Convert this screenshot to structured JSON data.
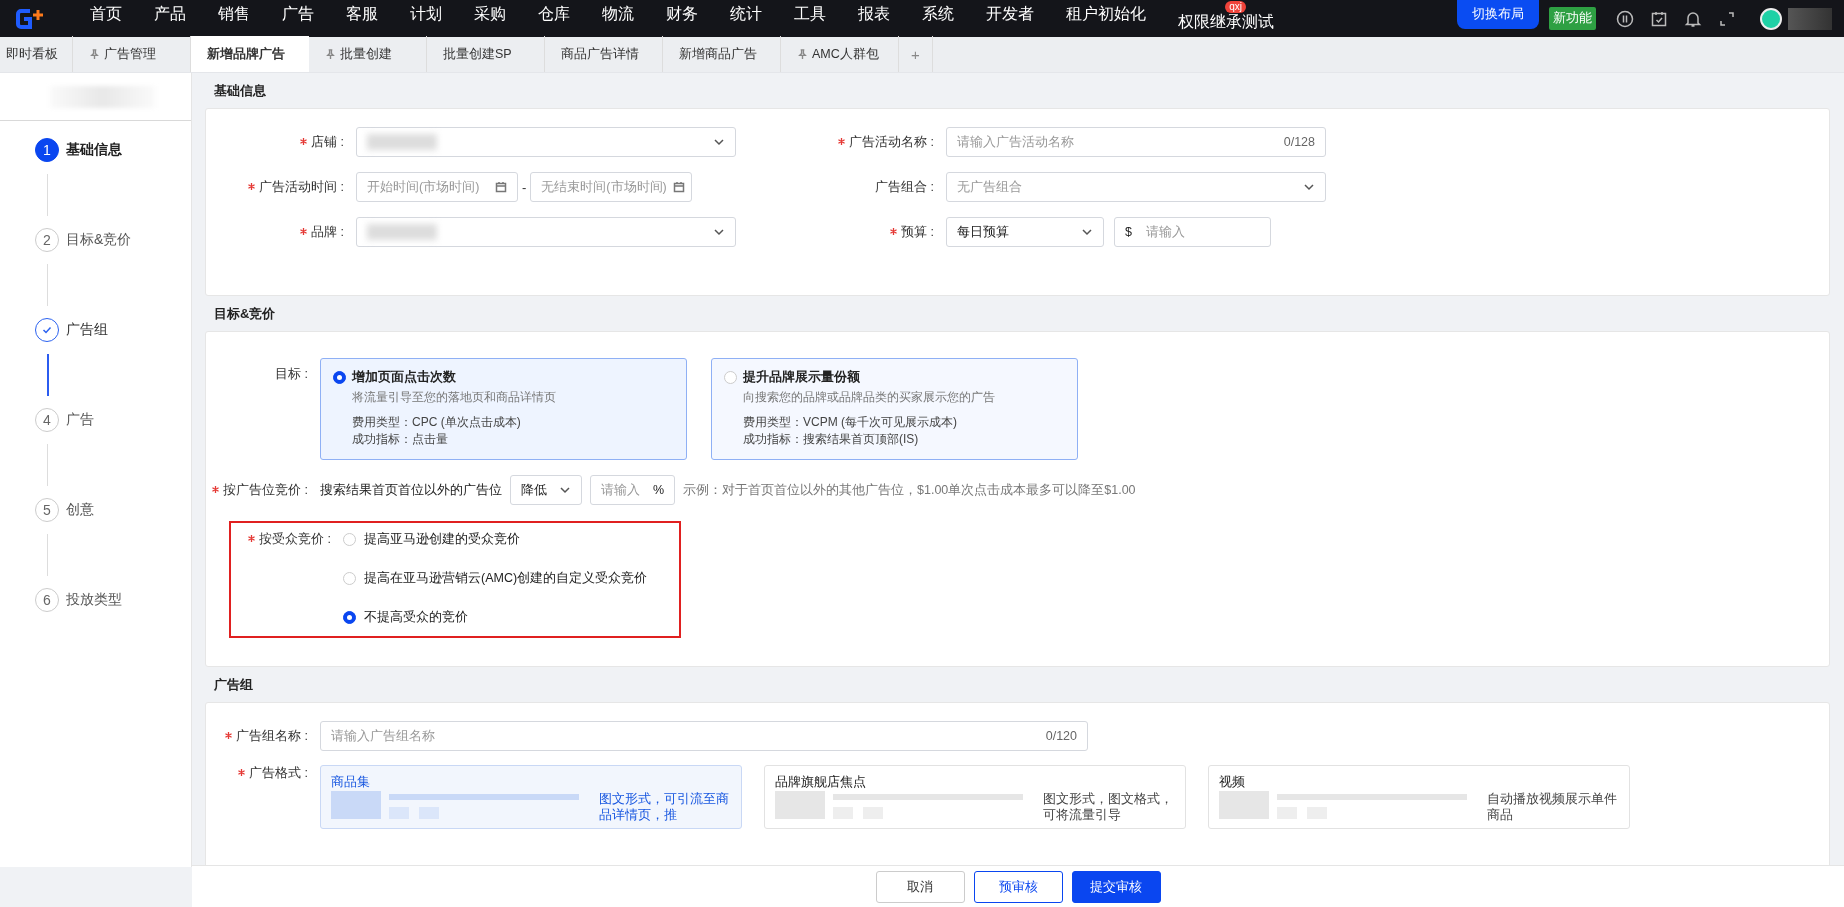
{
  "top_nav": {
    "menu": [
      "首页",
      "产品",
      "销售",
      "广告",
      "客服",
      "计划",
      "采购",
      "仓库",
      "物流",
      "财务",
      "统计",
      "工具",
      "报表",
      "系统",
      "开发者",
      "租户初始化",
      "权限继承测试"
    ],
    "badge": "qxj",
    "layout_button": "切换布局",
    "new_feature": "新功能"
  },
  "tabs": [
    {
      "label": "即时看板",
      "pinned": false,
      "selected": false
    },
    {
      "label": "广告管理",
      "pinned": true,
      "selected": false
    },
    {
      "label": "新增品牌广告",
      "pinned": false,
      "selected": true
    },
    {
      "label": "批量创建",
      "pinned": true,
      "selected": false
    },
    {
      "label": "批量创建SP",
      "pinned": false,
      "selected": false
    },
    {
      "label": "商品广告详情",
      "pinned": false,
      "selected": false
    },
    {
      "label": "新增商品广告",
      "pinned": false,
      "selected": false
    },
    {
      "label": "AMC人群包",
      "pinned": true,
      "selected": false
    }
  ],
  "add_tab": "+",
  "steps": [
    {
      "number": "1",
      "label": "基础信息",
      "kind": "active"
    },
    {
      "number": "2",
      "label": "目标&竞价",
      "kind": "wait"
    },
    {
      "label": "广告组",
      "kind": "done"
    },
    {
      "number": "4",
      "label": "广告",
      "kind": "wait"
    },
    {
      "number": "5",
      "label": "创意",
      "kind": "wait"
    },
    {
      "number": "6",
      "label": "投放类型",
      "kind": "wait"
    }
  ],
  "basic_info": {
    "title": "基础信息",
    "fields": [
      {
        "kind": "select",
        "label": "店铺 :",
        "required": true,
        "redacted": true
      },
      {
        "kind": "text",
        "label": "广告活动名称 :",
        "required": true,
        "placeholder": "请输入广告活动名称",
        "counter": "0/128"
      },
      {
        "kind": "daterange",
        "label": "广告活动时间 :",
        "required": true,
        "start_placeholder": "开始时间(市场时间)",
        "separator": "-",
        "end_placeholder": "无结束时间(市场时间)"
      },
      {
        "kind": "select",
        "label": "广告组合 :",
        "required": false,
        "placeholder": "无广告组合"
      },
      {
        "kind": "select",
        "label": "品牌 :",
        "required": true,
        "redacted": true
      },
      {
        "kind": "budget",
        "label": "预算 :",
        "required": true,
        "value": "每日预算",
        "prefix": "$",
        "placeholder": "请输入"
      }
    ]
  },
  "goal_bidding": {
    "title": "目标&竞价",
    "goal_label": "目标 :",
    "goals": [
      {
        "title": "增加页面点击次数",
        "description": "将流量引导至您的落地页和商品详情页",
        "cost_type": "费用类型：CPC (单次点击成本)",
        "metric": "成功指标：点击量",
        "selected": true
      },
      {
        "title": "提升品牌展示量份额",
        "description": "向搜索您的品牌或品牌品类的买家展示您的广告",
        "cost_type": "费用类型：VCPM (每千次可见展示成本)",
        "metric": "成功指标：搜索结果首页顶部(IS)",
        "selected": false
      }
    ],
    "placement_bid": {
      "label": "按广告位竞价 :",
      "required": true,
      "text": "搜索结果首页首位以外的广告位",
      "direction": "降低",
      "placeholder": "请输入",
      "suffix": "%",
      "hint": "示例：对于首页首位以外的其他广告位，$1.00单次点击成本最多可以降至$1.00"
    },
    "audience_bid": {
      "label": "按受众竞价 :",
      "required": true,
      "highlighted": true,
      "options": [
        {
          "label": "提高亚马逊创建的受众竞价",
          "selected": false
        },
        {
          "label": "提高在亚马逊营销云(AMC)创建的自定义受众竞价",
          "selected": false
        },
        {
          "label": "不提高受众的竞价",
          "selected": true
        }
      ]
    }
  },
  "ad_group": {
    "title": "广告组",
    "name_field": {
      "label": "广告组名称 :",
      "required": true,
      "placeholder": "请输入广告组名称",
      "counter": "0/120"
    },
    "format_label": "广告格式 :",
    "format_required": true,
    "formats": [
      {
        "title": "商品集",
        "description": "图文形式，可引流至商品详情页，推",
        "selected": true
      },
      {
        "title": "品牌旗舰店焦点",
        "description": "图文形式，图文格式，可将流量引导",
        "selected": false
      },
      {
        "title": "视频",
        "description": "自动播放视频展示单件商品",
        "selected": false
      }
    ]
  },
  "actions": [
    {
      "label": "取消",
      "kind": "default"
    },
    {
      "label": "预审核",
      "kind": "outline"
    },
    {
      "label": "提交审核",
      "kind": "primary"
    }
  ]
}
